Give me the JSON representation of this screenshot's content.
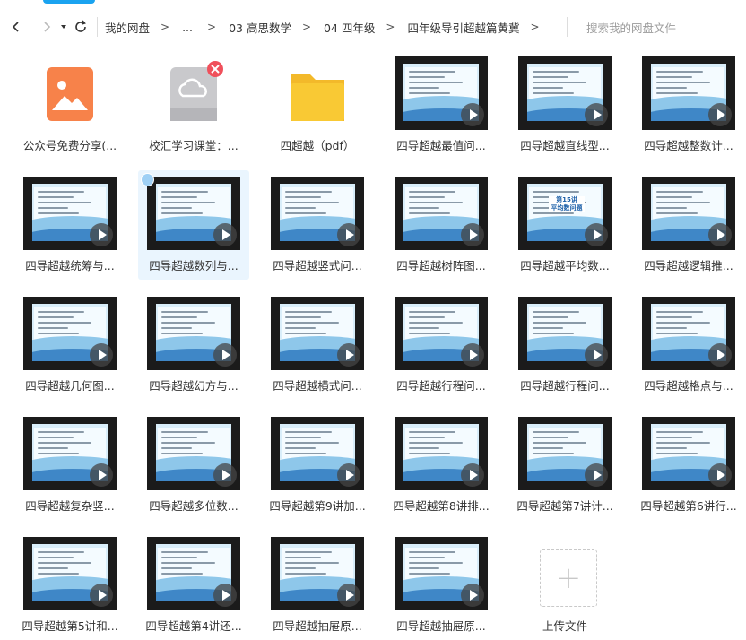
{
  "nav": {
    "back_icon": "chevron-left-icon",
    "forward_icon": "chevron-right-icon",
    "dropdown_icon": "caret-down-icon",
    "refresh_icon": "refresh-icon"
  },
  "breadcrumb": [
    "我的网盘",
    "...",
    "03 高思数学",
    "04 四年级",
    "四年级导引超越篇黄冀"
  ],
  "breadcrumb_sep": ">",
  "search": {
    "placeholder": "搜索我的网盘文件"
  },
  "files": [
    {
      "label": "公众号免费分享(...",
      "kind": "image-file"
    },
    {
      "label": "校汇学习课堂：...",
      "kind": "broken-file"
    },
    {
      "label": "四超越（pdf）",
      "kind": "folder"
    },
    {
      "label": "四导超越最值问...",
      "kind": "video"
    },
    {
      "label": "四导超越直线型...",
      "kind": "video"
    },
    {
      "label": "四导超越整数计...",
      "kind": "video"
    },
    {
      "label": "四导超越统筹与...",
      "kind": "video"
    },
    {
      "label": "四导超越数列与...",
      "kind": "video",
      "selected": true
    },
    {
      "label": "四导超越竖式问...",
      "kind": "video"
    },
    {
      "label": "四导超越树阵图...",
      "kind": "video"
    },
    {
      "label": "四导超越平均数...",
      "kind": "video",
      "slide_title": "第15讲",
      "slide_subtitle": "平均数问题"
    },
    {
      "label": "四导超越逻辑推...",
      "kind": "video"
    },
    {
      "label": "四导超越几何图...",
      "kind": "video"
    },
    {
      "label": "四导超越幻方与...",
      "kind": "video"
    },
    {
      "label": "四导超越横式问...",
      "kind": "video"
    },
    {
      "label": "四导超越行程问...",
      "kind": "video"
    },
    {
      "label": "四导超越行程问...",
      "kind": "video"
    },
    {
      "label": "四导超越格点与...",
      "kind": "video"
    },
    {
      "label": "四导超越复杂竖...",
      "kind": "video"
    },
    {
      "label": "四导超越多位数...",
      "kind": "video"
    },
    {
      "label": "四导超越第9讲加...",
      "kind": "video"
    },
    {
      "label": "四导超越第8讲排...",
      "kind": "video"
    },
    {
      "label": "四导超越第7讲计...",
      "kind": "video"
    },
    {
      "label": "四导超越第6讲行...",
      "kind": "video"
    },
    {
      "label": "四导超越第5讲和...",
      "kind": "video"
    },
    {
      "label": "四导超越第4讲还...",
      "kind": "video"
    },
    {
      "label": "四导超越抽屉原...",
      "kind": "video"
    },
    {
      "label": "四导超越抽屉原...",
      "kind": "video"
    },
    {
      "label": "上传文件",
      "kind": "upload"
    }
  ],
  "colors": {
    "accent": "#1aa3f0",
    "folder": "#f9c934",
    "image_file": "#f7824a",
    "error_badge": "#f0505b",
    "selected_bg": "#eaf5fe"
  }
}
